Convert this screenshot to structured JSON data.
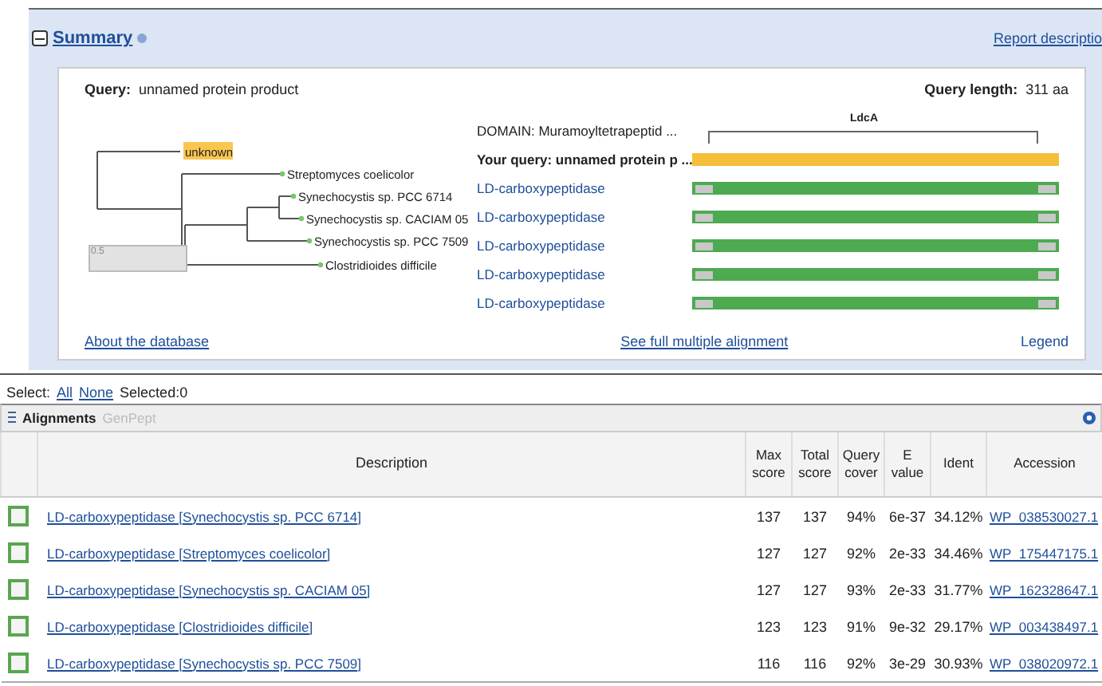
{
  "summary": {
    "title": "Summary",
    "report_link": "Report descriptio",
    "query_label": "Query:",
    "query": "unnamed protein product",
    "length_label": "Query length:",
    "length": "311 aa",
    "tree": {
      "query_leaf": "unknown",
      "leaves": [
        "Streptomyces coelicolor",
        "Synechocystis sp. PCC 6714",
        "Synechocystis sp. CACIAM 05",
        "Synechocystis sp. PCC 7509",
        "Clostridioides difficile"
      ],
      "scale": "0.5"
    },
    "domain": {
      "label": "DOMAIN: Muramoyltetrapeptid ...",
      "name": "LdcA"
    },
    "alignment_rows": [
      {
        "kind": "query",
        "label": "Your query: unnamed protein p ..."
      },
      {
        "kind": "hit",
        "label": "LD-carboxypeptidase"
      },
      {
        "kind": "hit",
        "label": "LD-carboxypeptidase"
      },
      {
        "kind": "hit",
        "label": "LD-carboxypeptidase"
      },
      {
        "kind": "hit",
        "label": "LD-carboxypeptidase"
      },
      {
        "kind": "hit",
        "label": "LD-carboxypeptidase"
      }
    ],
    "about_link": "About the database",
    "msa_link": "See full multiple alignment",
    "legend": "Legend"
  },
  "select": {
    "label": "Select:",
    "all": "All",
    "none": "None",
    "selected": "Selected:0"
  },
  "tabs": [
    {
      "label": "Alignments",
      "selected": true
    },
    {
      "label": "GenPept",
      "selected": false
    }
  ],
  "table": {
    "columns": [
      "Description",
      "Max score",
      "Total score",
      "Query cover",
      "E value",
      "Ident",
      "Accession"
    ],
    "rows": [
      {
        "checked": false,
        "description": "LD-carboxypeptidase [Synechocystis sp. PCC 6714]",
        "max_score": "137",
        "total_score": "137",
        "query_cover": "94%",
        "e_value": "6e-37",
        "ident": "34.12%",
        "accession": "WP_038530027.1"
      },
      {
        "checked": false,
        "description": "LD-carboxypeptidase [Streptomyces coelicolor]",
        "max_score": "127",
        "total_score": "127",
        "query_cover": "92%",
        "e_value": "2e-33",
        "ident": "34.46%",
        "accession": "WP_175447175.1"
      },
      {
        "checked": false,
        "description": "LD-carboxypeptidase [Synechocystis sp. CACIAM 05]",
        "max_score": "127",
        "total_score": "127",
        "query_cover": "93%",
        "e_value": "2e-33",
        "ident": "31.77%",
        "accession": "WP_162328647.1"
      },
      {
        "checked": false,
        "description": "LD-carboxypeptidase [Clostridioides difficile]",
        "max_score": "123",
        "total_score": "123",
        "query_cover": "91%",
        "e_value": "9e-32",
        "ident": "29.17%",
        "accession": "WP_003438497.1"
      },
      {
        "checked": false,
        "description": "LD-carboxypeptidase [Synechocystis sp. PCC 7509]",
        "max_score": "116",
        "total_score": "116",
        "query_cover": "92%",
        "e_value": "3e-29",
        "ident": "30.93%",
        "accession": "WP_038020972.1"
      }
    ]
  }
}
